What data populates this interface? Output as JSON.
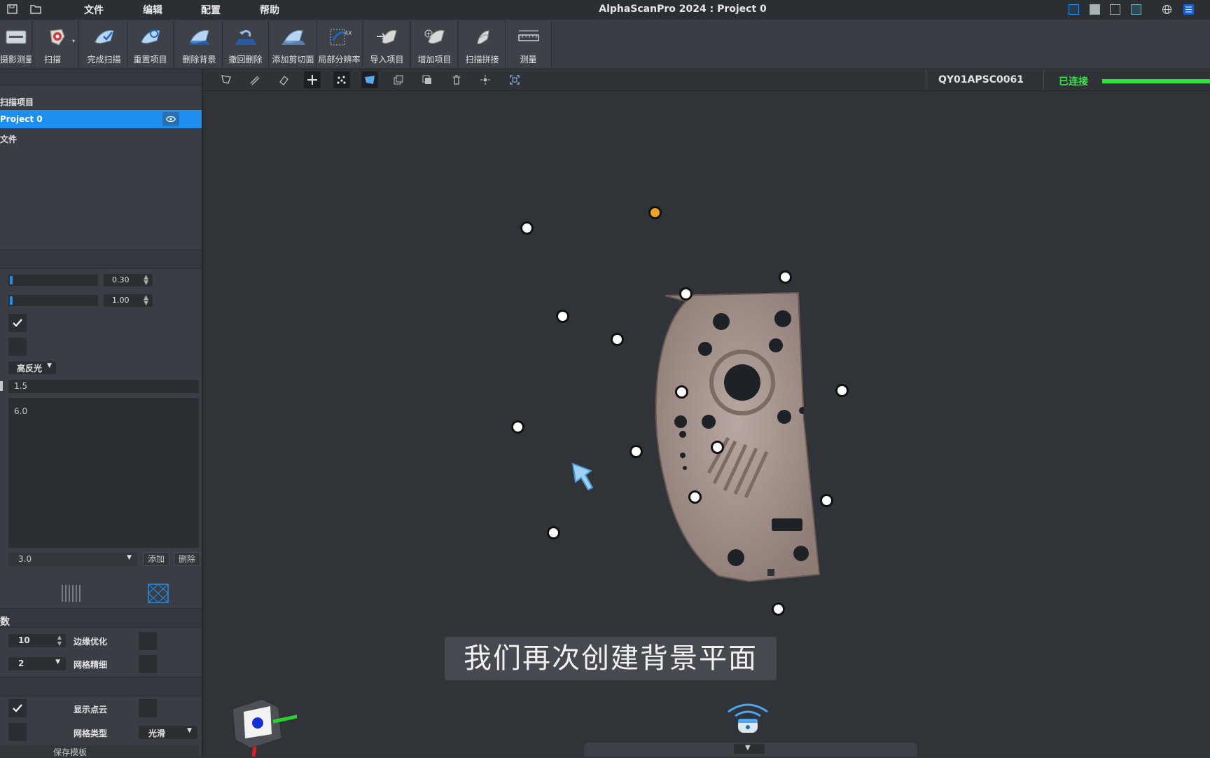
{
  "app": {
    "title": "AlphaScanPro 2024 : Project 0"
  },
  "menu": {
    "file": "文件",
    "edit": "编辑",
    "config": "配置",
    "help": "帮助"
  },
  "toolbar": {
    "items": [
      {
        "label": "摄影测量",
        "icon": "photogrammetry-icon"
      },
      {
        "label": "扫描",
        "icon": "scan-icon"
      },
      {
        "label": "完成扫描",
        "icon": "finish-scan-icon"
      },
      {
        "label": "重置项目",
        "icon": "reset-project-icon"
      },
      {
        "label": "删除背景",
        "icon": "delete-background-icon"
      },
      {
        "label": "撤回删除",
        "icon": "undo-delete-icon"
      },
      {
        "label": "添加剪切面",
        "icon": "add-cut-plane-icon"
      },
      {
        "label": "局部分辨率",
        "icon": "local-resolution-icon"
      },
      {
        "label": "导入项目",
        "icon": "import-project-icon"
      },
      {
        "label": "增加项目",
        "icon": "add-project-icon"
      },
      {
        "label": "扫描拼接",
        "icon": "scan-merge-icon"
      },
      {
        "label": "测量",
        "icon": "measure-icon"
      }
    ]
  },
  "device": {
    "id": "QY01APSC0061",
    "status": "已连接",
    "status_color": "#3be04a"
  },
  "tree": {
    "header": "扫描项目",
    "project": "Project 0",
    "files": "文件"
  },
  "settings": {
    "slider1_value": "0.30",
    "slider2_value": "1.00",
    "check1": true,
    "check2": false,
    "mode_dropdown": "高反光",
    "point_distance": "1.5",
    "list_value": "6.0",
    "resolution_select": "3.0",
    "add_label": "添加",
    "delete_label": "删除"
  },
  "mesh": {
    "section_title": "数",
    "iterations": "10",
    "edge_opt_label": "边缘优化",
    "edge_opt": false,
    "level": "2",
    "mesh_refine_label": "网格精细",
    "mesh_refine": false
  },
  "display": {
    "show_cloud_check": true,
    "show_cloud_label": "显示点云",
    "show_cloud_toggle": false,
    "mesh_type_label": "网格类型",
    "mesh_type_value": "光滑",
    "save_template": "保存模板"
  },
  "subtitle": "我们再次创建背景平面",
  "colors": {
    "accent": "#1e8ff0",
    "connected": "#3be04a",
    "target_orange": "#f2a21f",
    "part": "#a89590"
  }
}
